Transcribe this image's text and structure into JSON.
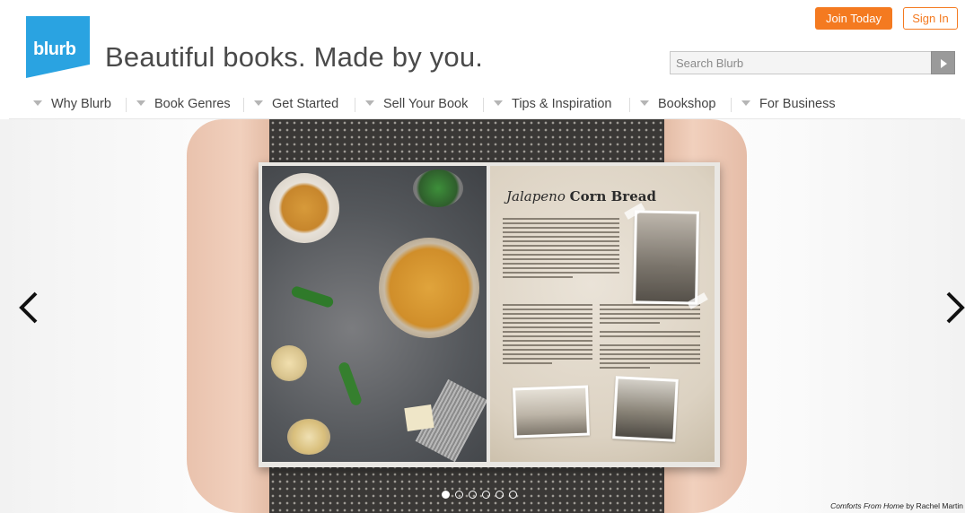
{
  "brand": {
    "logo_text": "blurb",
    "tagline": "Beautiful books. Made by you.",
    "accent": "#f47a20",
    "logo_color": "#2aa3e1"
  },
  "account": {
    "join_label": "Join Today",
    "signin_label": "Sign In"
  },
  "search": {
    "placeholder": "Search Blurb"
  },
  "nav": {
    "items": [
      {
        "label": "Why Blurb"
      },
      {
        "label": "Book Genres"
      },
      {
        "label": "Get Started"
      },
      {
        "label": "Sell Your Book"
      },
      {
        "label": "Tips & Inspiration"
      },
      {
        "label": "Bookshop"
      },
      {
        "label": "For Business"
      }
    ]
  },
  "hero": {
    "recipe_title_script": "Jalapeno",
    "recipe_title_bold": "Corn Bread",
    "caption_title": "Comforts From Home",
    "caption_by": "by Rachel Martin",
    "carousel": {
      "slide_count": 6,
      "active_index": 0
    },
    "icons": {
      "prev": "chevron-left-icon",
      "next": "chevron-right-icon"
    }
  }
}
